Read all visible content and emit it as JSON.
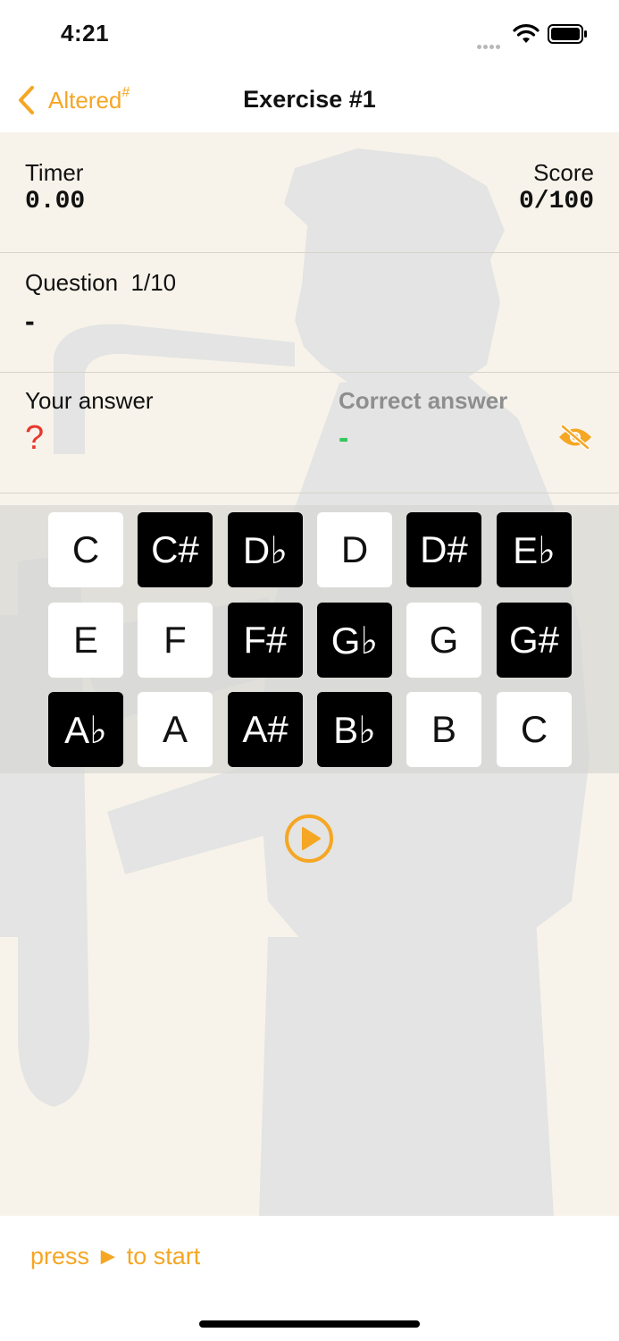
{
  "status_bar": {
    "time": "4:21"
  },
  "nav": {
    "back_label": "Altered",
    "back_suffix": "#",
    "title": "Exercise #1"
  },
  "stats": {
    "timer_label": "Timer",
    "timer_value": "0.00",
    "score_label": "Score",
    "score_value": "0/100"
  },
  "question": {
    "label": "Question",
    "counter": "1/10",
    "value": "-"
  },
  "answers": {
    "your_label": "Your answer",
    "your_value": "?",
    "correct_label": "Correct answer",
    "correct_value": "-"
  },
  "keys": [
    {
      "label": "C",
      "color": "white"
    },
    {
      "label": "C#",
      "color": "black"
    },
    {
      "label": "D♭",
      "color": "black"
    },
    {
      "label": "D",
      "color": "white"
    },
    {
      "label": "D#",
      "color": "black"
    },
    {
      "label": "E♭",
      "color": "black"
    },
    {
      "label": "E",
      "color": "white"
    },
    {
      "label": "F",
      "color": "white"
    },
    {
      "label": "F#",
      "color": "black"
    },
    {
      "label": "G♭",
      "color": "black"
    },
    {
      "label": "G",
      "color": "white"
    },
    {
      "label": "G#",
      "color": "black"
    },
    {
      "label": "A♭",
      "color": "black"
    },
    {
      "label": "A",
      "color": "white"
    },
    {
      "label": "A#",
      "color": "black"
    },
    {
      "label": "B♭",
      "color": "black"
    },
    {
      "label": "B",
      "color": "white"
    },
    {
      "label": "C",
      "color": "white"
    }
  ],
  "footer": {
    "hint": "press ► to start"
  },
  "colors": {
    "accent": "#F5A623",
    "error": "#E8372C",
    "success": "#34C759",
    "muted": "#8E8E8E"
  },
  "icons": {
    "back": "chevron-left-icon",
    "reveal": "eye-slash-icon",
    "play": "play-circle-icon"
  }
}
